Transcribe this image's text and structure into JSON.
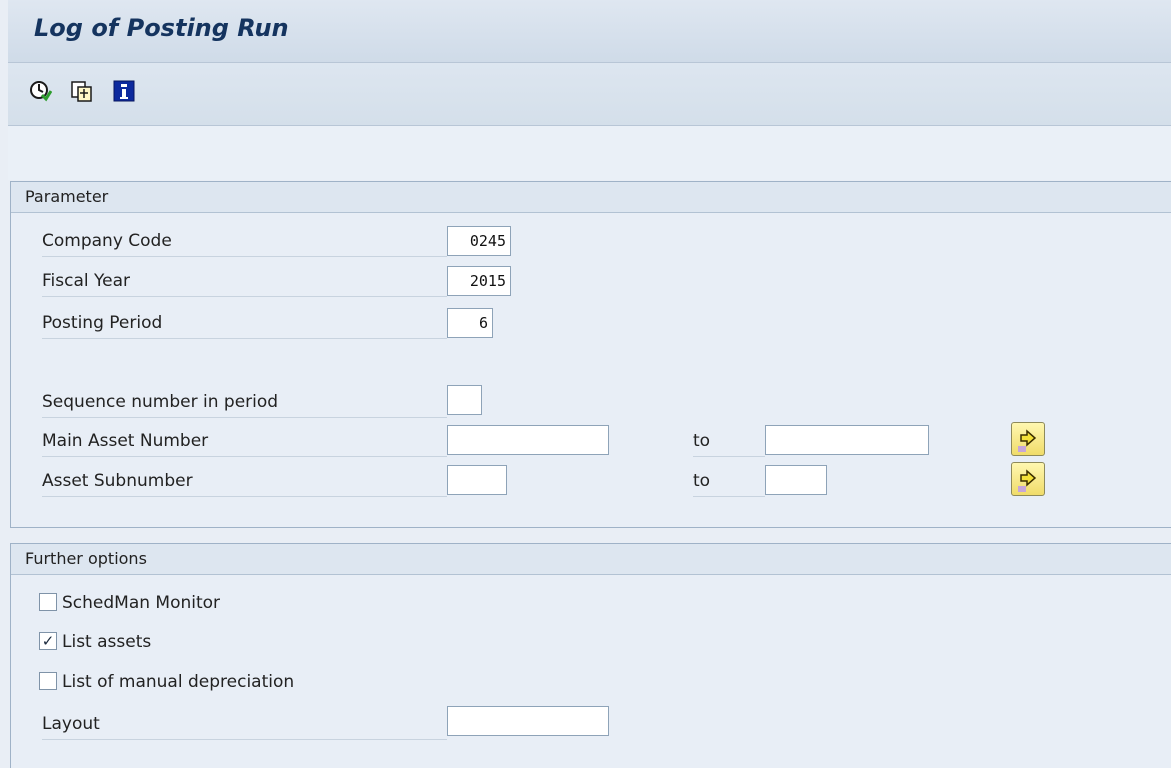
{
  "window": {
    "title": "Log of Posting Run"
  },
  "toolbar": {
    "buttons": [
      {
        "icon": "execute-icon"
      },
      {
        "icon": "copy-icon"
      },
      {
        "icon": "info-icon"
      }
    ]
  },
  "parameter": {
    "header": "Parameter",
    "company_code": {
      "label": "Company Code",
      "value": "0245"
    },
    "fiscal_year": {
      "label": "Fiscal Year",
      "value": "2015"
    },
    "posting_period": {
      "label": "Posting Period",
      "value": "6"
    },
    "sequence_number": {
      "label": "Sequence number in period",
      "value": ""
    },
    "main_asset_number": {
      "label": "Main Asset Number",
      "from": "",
      "to_label": "to",
      "to": ""
    },
    "asset_subnumber": {
      "label": "Asset Subnumber",
      "from": "",
      "to_label": "to",
      "to": ""
    }
  },
  "further_options": {
    "header": "Further options",
    "schedman_monitor": {
      "label": "SchedMan Monitor",
      "checked": false
    },
    "list_assets": {
      "label": "List assets",
      "checked": true
    },
    "list_manual_depreciation": {
      "label": "List of manual depreciation",
      "checked": false
    },
    "layout": {
      "label": "Layout",
      "value": ""
    }
  },
  "colors": {
    "title": "#15345f",
    "background": "#e9eef5",
    "multiple_selection": "#f0dc6a"
  }
}
